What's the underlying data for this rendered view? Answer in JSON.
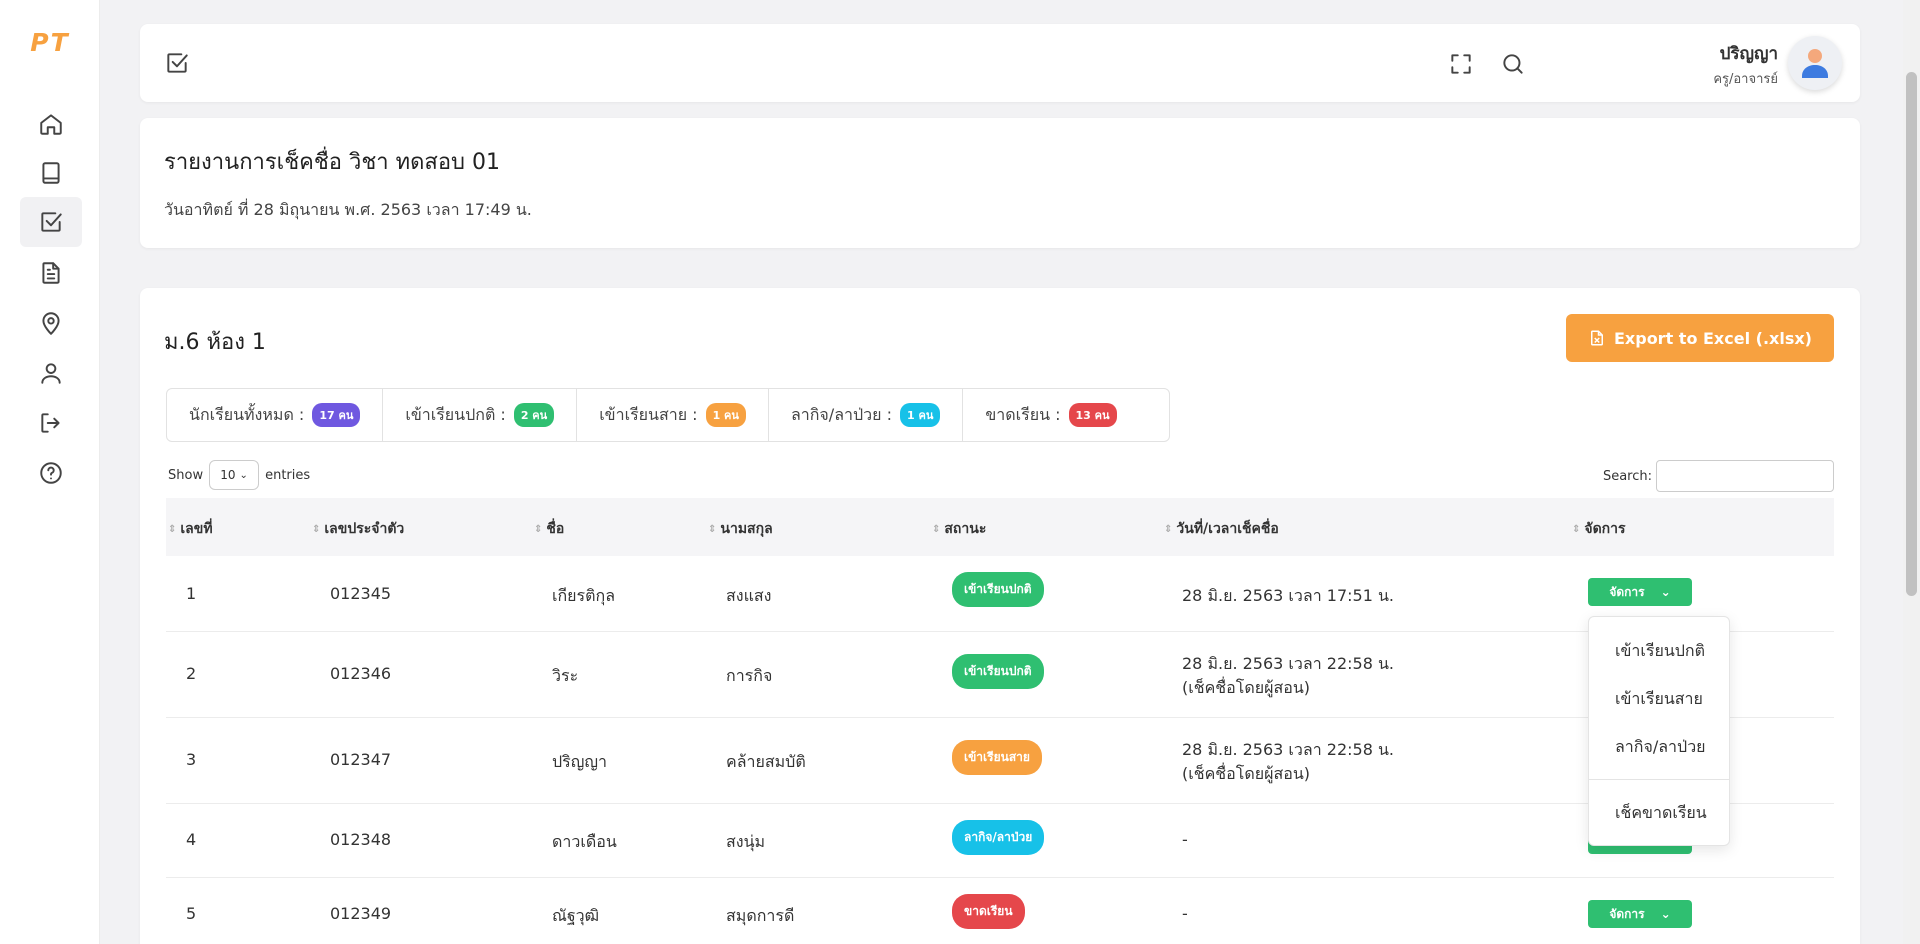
{
  "app": {
    "logo": "PT"
  },
  "header": {
    "user_name": "ปริญญา",
    "user_role": "ครู/อาจารย์"
  },
  "report": {
    "title": "รายงานการเช็คชื่อ วิชา ทดสอบ 01",
    "date": "วันอาทิตย์ ที่ 28 มิถุนายน พ.ศ. 2563 เวลา 17:49 น."
  },
  "classroom": {
    "title": "ม.6 ห้อง 1",
    "export_label": "Export to Excel (.xlsx)"
  },
  "summary": [
    {
      "label": "นักเรียนทั้งหมด :",
      "badge": "17 คน",
      "color": "#6f58e0"
    },
    {
      "label": "เข้าเรียนปกติ :",
      "badge": "2 คน",
      "color": "#2fbf71"
    },
    {
      "label": "เข้าเรียนสาย :",
      "badge": "1 คน",
      "color": "#f7a140"
    },
    {
      "label": "ลากิจ/ลาป่วย :",
      "badge": "1 คน",
      "color": "#17c1e8"
    },
    {
      "label": "ขาดเรียน :",
      "badge": "13 คน",
      "color": "#e5474b"
    }
  ],
  "table_controls": {
    "show_label": "Show",
    "entries_value": "10",
    "entries_label": "entries",
    "search_label": "Search:"
  },
  "table": {
    "headers": [
      "เลขที่",
      "เลขประจำตัว",
      "ชื่อ",
      "นามสกุล",
      "สถานะ",
      "วันที่/เวลาเช็คชื่อ",
      "จัดการ"
    ],
    "manage_label": "จัดการ",
    "rows": [
      {
        "no": "1",
        "id": "012345",
        "first": "เกียรติกุล",
        "last": "สงแสง",
        "status": "เข้าเรียนปกติ",
        "status_color": "#2fbf71",
        "time": "28 มิ.ย. 2563 เวลา 17:51 น.",
        "note": ""
      },
      {
        "no": "2",
        "id": "012346",
        "first": "วิระ",
        "last": "การกิจ",
        "status": "เข้าเรียนปกติ",
        "status_color": "#2fbf71",
        "time": "28 มิ.ย. 2563 เวลา 22:58 น.",
        "note": "(เช็คชื่อโดยผู้สอน)"
      },
      {
        "no": "3",
        "id": "012347",
        "first": "ปริญญา",
        "last": "คล้ายสมบัติ",
        "status": "เข้าเรียนสาย",
        "status_color": "#f7a140",
        "time": "28 มิ.ย. 2563 เวลา 22:58 น.",
        "note": "(เช็คชื่อโดยผู้สอน)"
      },
      {
        "no": "4",
        "id": "012348",
        "first": "ดาวเดือน",
        "last": "สงนุ่ม",
        "status": "ลากิจ/ลาป่วย",
        "status_color": "#17c1e8",
        "time": "-",
        "note": ""
      },
      {
        "no": "5",
        "id": "012349",
        "first": "ณัฐวุฒิ",
        "last": "สมุดการดี",
        "status": "ขาดเรียน",
        "status_color": "#e5474b",
        "time": "-",
        "note": ""
      }
    ]
  },
  "dropdown": {
    "items": [
      "เข้าเรียนปกติ",
      "เข้าเรียนสาย",
      "ลากิจ/ลาป่วย",
      "เช็คขาดเรียน"
    ]
  }
}
